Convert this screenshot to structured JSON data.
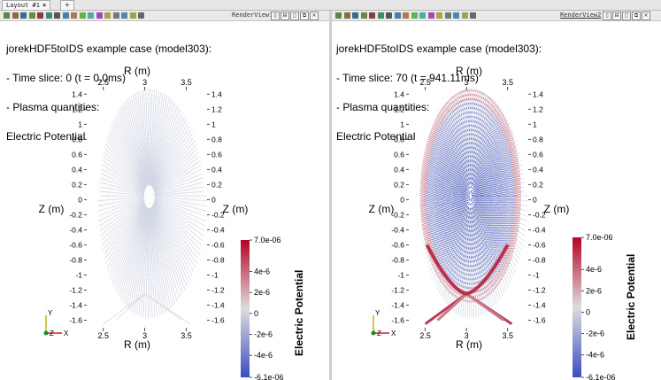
{
  "layout_tab": {
    "label": "Layout #1",
    "close": "×",
    "add": "+"
  },
  "views": [
    {
      "title": "RenderView1",
      "info_lines": [
        "jorekHDF5toIDS example case (model303):",
        "- Time slice: 0 (t = 0.0ms)",
        "- Plasma quantities:",
        "Electric Potential"
      ],
      "intensity": 0
    },
    {
      "title": "RenderView2",
      "info_lines": [
        "jorekHDF5toIDS example case (model303):",
        "- Time slice: 70 (t = 941.11ms)",
        "- Plasma quantities:",
        "Electric Potential"
      ],
      "intensity": 1
    }
  ],
  "axes": {
    "x_label": "R (m)",
    "y_label": "Z (m)",
    "x_ticks": [
      "2.5",
      "3",
      "3.5"
    ],
    "y_ticks": [
      "1.4",
      "1.2",
      "1",
      "0.8",
      "0.6",
      "0.4",
      "0.2",
      "0",
      "-0.2",
      "-0.4",
      "-0.6",
      "-0.8",
      "-1",
      "-1.2",
      "-1.4",
      "-1.6"
    ]
  },
  "colorbars": [
    {
      "title": "Electric Potential",
      "ticks": [
        "7.0e-06",
        "4e-6",
        "2e-6",
        "0",
        "-2e-6",
        "-4e-6",
        "-6.1e-06"
      ],
      "range": [
        -6.1e-06,
        7e-06
      ]
    },
    {
      "title": "Electric Potential",
      "ticks": [
        "7.0e-06",
        "4e-6",
        "2e-6",
        "0",
        "-2e-6",
        "-4e-6",
        "-6.1e-06"
      ],
      "range": [
        -6.1e-06,
        7e-06
      ]
    }
  ],
  "orientation_axes": {
    "x": "X",
    "y": "Y",
    "z": "Z"
  },
  "colors": {
    "low": "#3b4cc0",
    "mid": "#dddddd",
    "high": "#b40426"
  },
  "view_buttons": [
    "▯",
    "⊟",
    "◻",
    "⧉",
    "×"
  ],
  "toolbar_icons": [
    "reset-camera-icon",
    "zoom-to-data-icon",
    "2d-3d-toggle-icon",
    "camera-x-icon",
    "camera-y-icon",
    "camera-z-icon",
    "rotate-icon",
    "select-cells-icon",
    "select-points-icon",
    "select-block-icon",
    "interactive-select-icon",
    "hover-cells-icon",
    "hover-points-icon",
    "clear-selection-icon",
    "grow-selection-icon",
    "shrink-selection-icon",
    "capture-screenshot-icon"
  ]
}
